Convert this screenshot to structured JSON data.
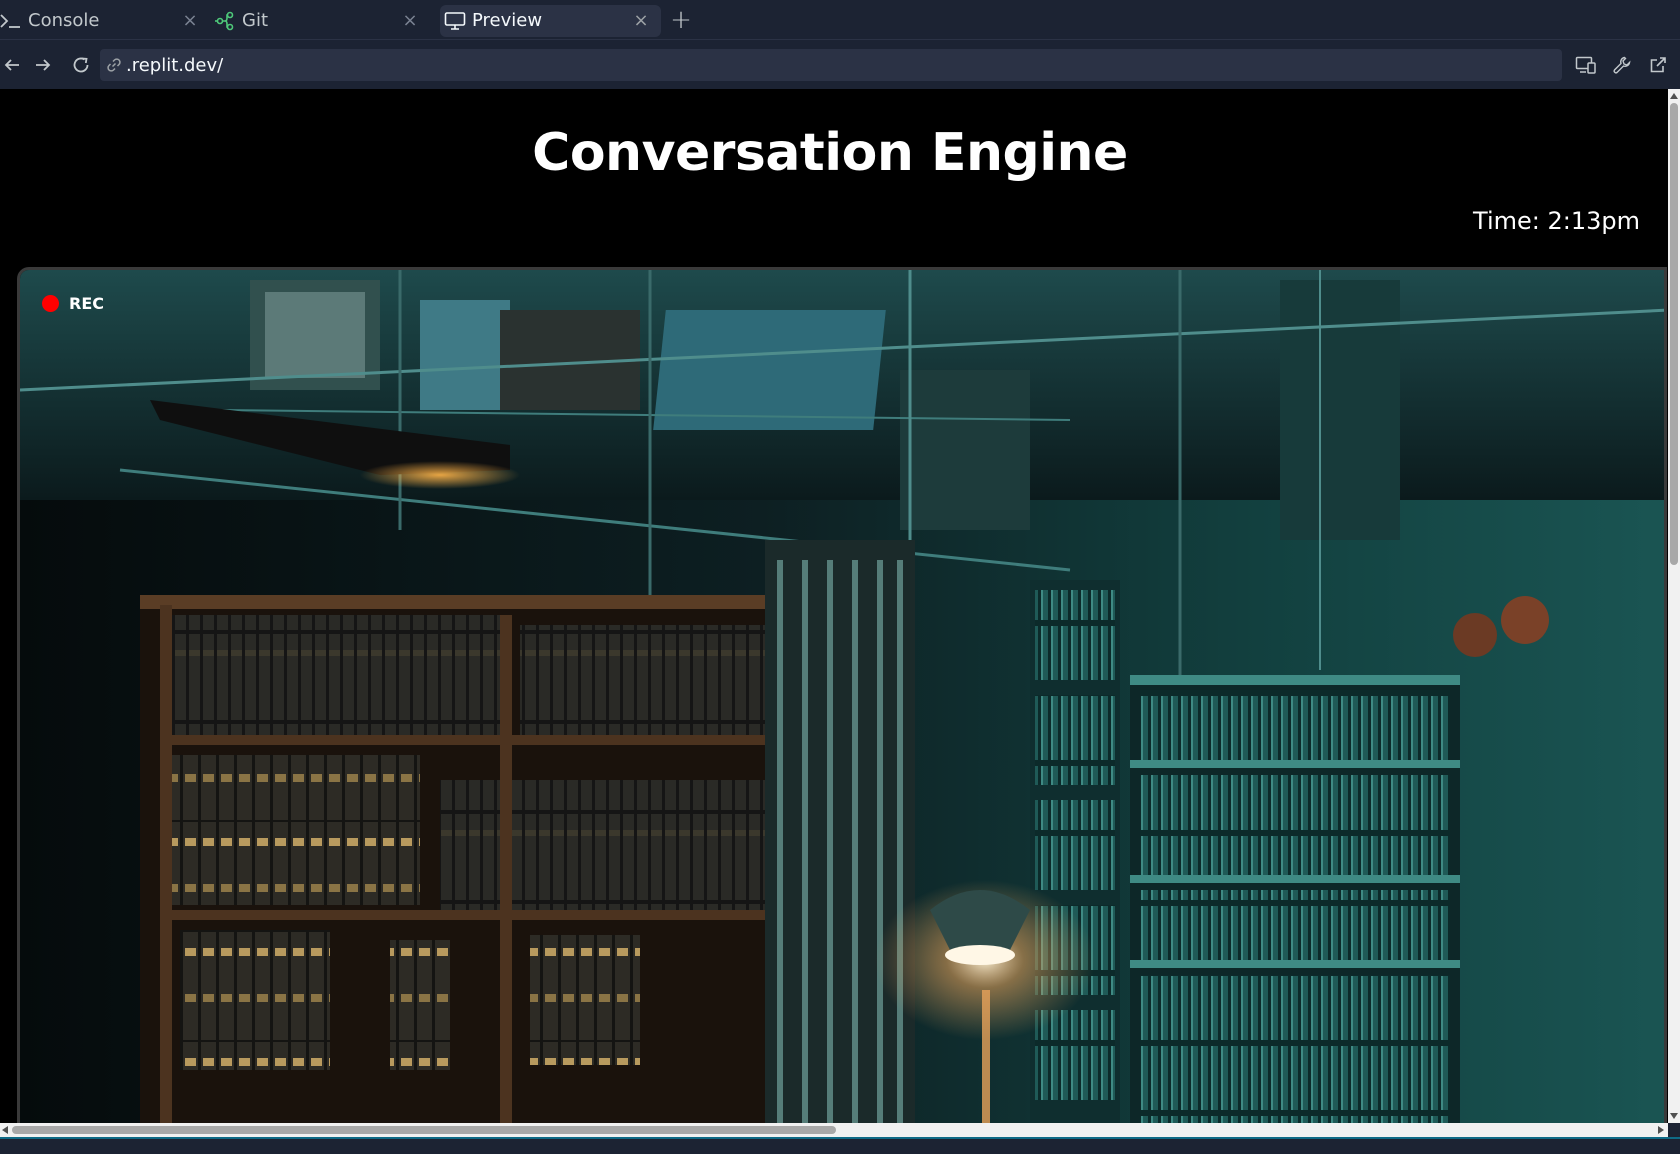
{
  "tabs": [
    {
      "label": "Console",
      "icon": "terminal-icon"
    },
    {
      "label": "Git",
      "icon": "git-branch-icon"
    },
    {
      "label": "Preview",
      "icon": "monitor-icon",
      "active": true
    }
  ],
  "address": {
    "url": ".replit.dev/"
  },
  "page": {
    "title": "Conversation Engine",
    "time": "Time: 2:13pm",
    "rec_label": "REC"
  },
  "colors": {
    "rec_dot": "#ff0000",
    "chrome_bg": "#1c2333",
    "active_tab_bg": "#2b3245"
  }
}
